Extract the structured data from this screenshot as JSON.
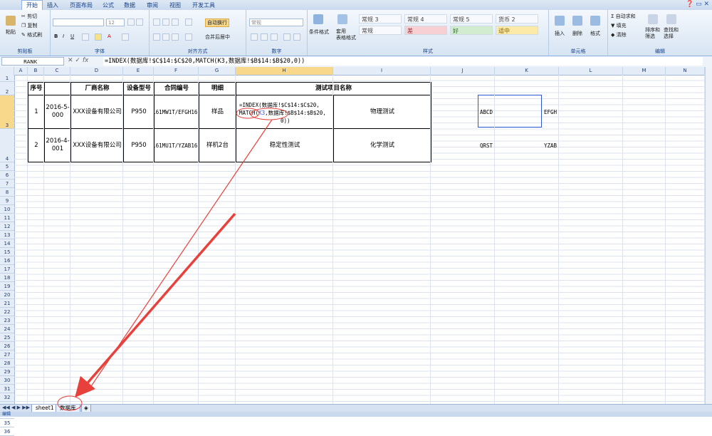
{
  "ribbon": {
    "tabs": [
      "开始",
      "插入",
      "页面布局",
      "公式",
      "数据",
      "审阅",
      "视图",
      "开发工具"
    ],
    "clipboard": {
      "paste": "粘贴",
      "cut": "剪切",
      "copy": "复制",
      "format_painter": "格式刷",
      "label": "剪贴板"
    },
    "font": {
      "name": "",
      "size": "12",
      "label": "字体"
    },
    "alignment": {
      "wrap": "自动换行",
      "merge": "合并后居中",
      "label": "对齐方式"
    },
    "number": {
      "format": "常规",
      "label": "数字"
    },
    "styles": {
      "conditional": "条件格式",
      "table_format": "套用\n表格格式",
      "cells": [
        "常规 3",
        "常规 4",
        "常规 5",
        "货币 2",
        "常规",
        "差",
        "好",
        "适中"
      ],
      "label": "样式"
    },
    "cells_group": {
      "insert": "插入",
      "delete": "删除",
      "format": "格式",
      "label": "单元格"
    },
    "editing": {
      "autosum": "自动求和",
      "fill": "填充",
      "clear": "清除",
      "sort": "排序和\n筛选",
      "find": "查找和\n选择",
      "label": "编辑"
    }
  },
  "formula_bar": {
    "name_box": "RANK",
    "formula": "=INDEX(数据库!$C$14:$C$20,MATCH(K3,数据库!$B$14:$B$20,0))"
  },
  "columns": [
    "A",
    "B",
    "C",
    "D",
    "E",
    "F",
    "G",
    "H",
    "I",
    "J",
    "K",
    "L",
    "M",
    "N"
  ],
  "rows": [
    "1",
    "2",
    "3",
    "4",
    "5",
    "6",
    "7",
    "8",
    "9",
    "10",
    "11",
    "12",
    "13",
    "14",
    "15",
    "16",
    "17",
    "18",
    "19",
    "20",
    "21",
    "22",
    "23",
    "24",
    "25",
    "26",
    "27",
    "28",
    "29",
    "30",
    "31",
    "32",
    "33",
    "34",
    "35",
    "36"
  ],
  "table": {
    "headers": {
      "no": "序号",
      "factory": "厂商名称",
      "model": "设备型号",
      "contract": "合同编号",
      "detail": "明细",
      "test": "测试项目名称"
    },
    "row1": {
      "no": "1",
      "date": "2016-5-000",
      "factory": "XXX设备有限公司",
      "model": "P950",
      "contract": "ABCD161MW1T/EFGH161MX1T",
      "detail": "样品",
      "edit_line1": "=INDEX(数据库!$C$14:$C$20,",
      "edit_line2_a": "MATCH(",
      "edit_line2_b": "K3",
      "edit_line2_c": ",数据库!$B$14:$B$20,",
      "edit_line3": "0))",
      "test2": "物理测试"
    },
    "row2": {
      "no": "2",
      "date": "2016-4-001",
      "factory": "XXX设备有限公司",
      "model": "P950",
      "contract": "QRST161MU1T/YZAB161MV1T",
      "detail": "样机2台",
      "test1": "稳定性测试",
      "test2": "化学测试"
    }
  },
  "lookup": {
    "k3": "ABCD",
    "l3": "EFGH",
    "k4": "QRST",
    "l4": "YZAB"
  },
  "sheets": [
    "sheet1",
    "数据库"
  ],
  "status": {
    "mode": "编辑"
  },
  "colors": {
    "ribbon": "#dfe9f5",
    "selection": "#f8d88a",
    "range_blue": "#2b57d6",
    "annotation_red": "#e8403a"
  }
}
